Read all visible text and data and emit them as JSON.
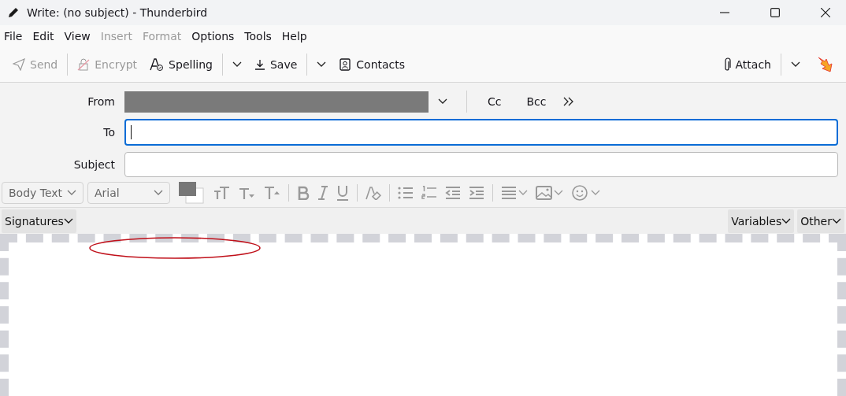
{
  "window": {
    "title": "Write: (no subject) - Thunderbird"
  },
  "menu": [
    {
      "label": "File",
      "disabled": false
    },
    {
      "label": "Edit",
      "disabled": false
    },
    {
      "label": "View",
      "disabled": false
    },
    {
      "label": "Insert",
      "disabled": true
    },
    {
      "label": "Format",
      "disabled": true
    },
    {
      "label": "Options",
      "disabled": false
    },
    {
      "label": "Tools",
      "disabled": false
    },
    {
      "label": "Help",
      "disabled": false
    }
  ],
  "toolbar": {
    "send": {
      "label": "Send",
      "disabled": true
    },
    "encrypt": {
      "label": "Encrypt",
      "disabled": true
    },
    "spelling": {
      "label": "Spelling",
      "disabled": false
    },
    "save": {
      "label": "Save",
      "disabled": false
    },
    "contacts": {
      "label": "Contacts",
      "disabled": false
    },
    "attach": {
      "label": "Attach",
      "disabled": false
    }
  },
  "header": {
    "from": {
      "label": "From"
    },
    "cc": "Cc",
    "bcc": "Bcc",
    "to": {
      "label": "To",
      "focused": true
    },
    "subject": {
      "label": "Subject",
      "focused": false
    }
  },
  "format_toolbar": {
    "paragraph_format": "Body Text",
    "font": "Arial"
  },
  "addon_bar": {
    "signatures": "Signatures",
    "variables": "Variables",
    "other": "Other"
  }
}
